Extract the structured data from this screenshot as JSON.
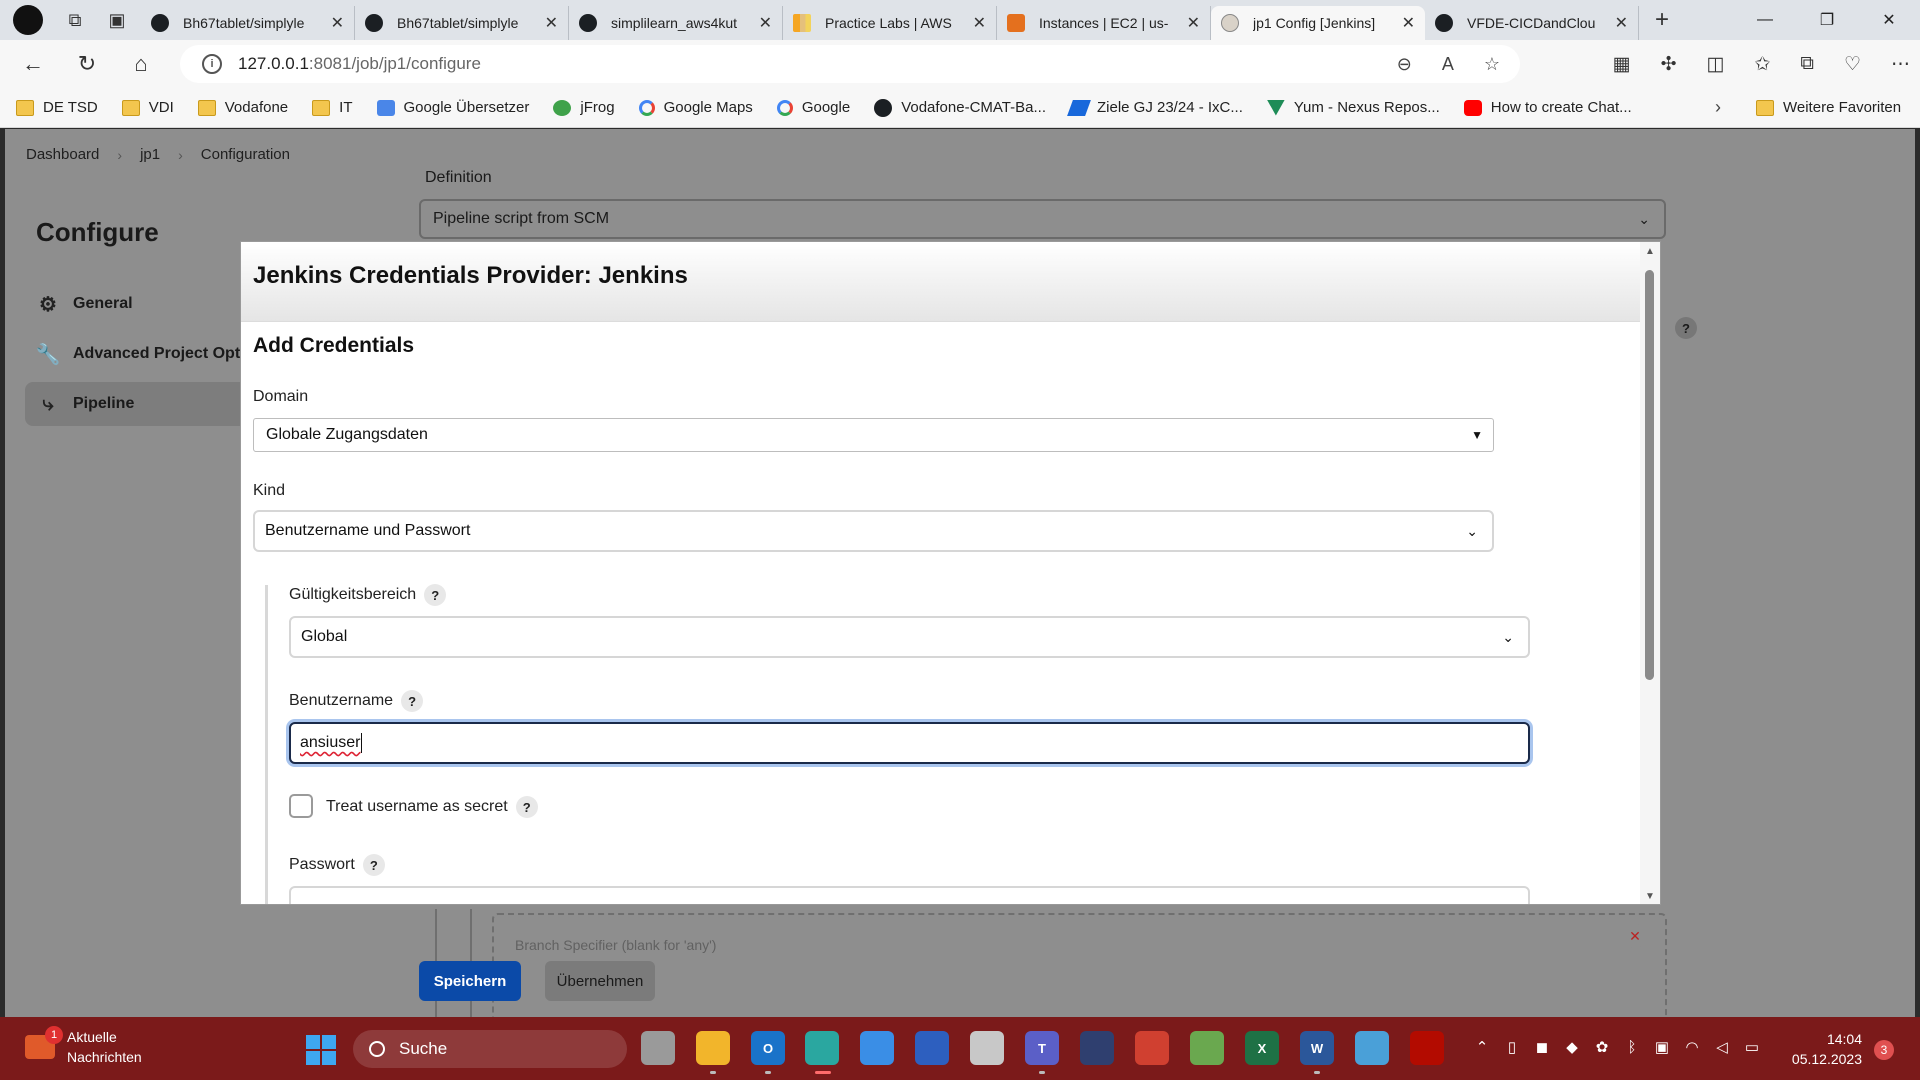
{
  "browser": {
    "tabs": [
      {
        "title": "Bh67tablet/simplyle",
        "icon": "github-icon"
      },
      {
        "title": "Bh67tablet/simplyle",
        "icon": "github-icon"
      },
      {
        "title": "simplilearn_aws4kut",
        "icon": "github-icon"
      },
      {
        "title": "Practice Labs | AWS",
        "icon": "practice-labs-icon"
      },
      {
        "title": "Instances | EC2 | us-",
        "icon": "aws-ec2-icon"
      },
      {
        "title": "jp1 Config [Jenkins]",
        "icon": "jenkins-icon",
        "active": true
      },
      {
        "title": "VFDE-CICDandClou",
        "icon": "github-icon"
      }
    ],
    "url_host": "127.0.0.1",
    "url_rest": ":8081/job/jp1/configure",
    "favorites": [
      {
        "label": "DE TSD",
        "icon": "folder-icon"
      },
      {
        "label": "VDI",
        "icon": "folder-icon"
      },
      {
        "label": "Vodafone",
        "icon": "folder-icon"
      },
      {
        "label": "IT",
        "icon": "folder-icon"
      },
      {
        "label": "Google Übersetzer",
        "icon": "google-translate-icon"
      },
      {
        "label": "jFrog",
        "icon": "jfrog-icon"
      },
      {
        "label": "Google Maps",
        "icon": "google-icon"
      },
      {
        "label": "Google",
        "icon": "google-icon"
      },
      {
        "label": "Vodafone-CMAT-Ba...",
        "icon": "github-icon"
      },
      {
        "label": "Ziele GJ 23/24 - IxC...",
        "icon": "confluence-icon"
      },
      {
        "label": "Yum - Nexus Repos...",
        "icon": "nexus-icon"
      },
      {
        "label": "How to create Chat...",
        "icon": "youtube-icon"
      }
    ],
    "more_favorites": "Weitere Favoriten"
  },
  "jenkins": {
    "breadcrumb": [
      "Dashboard",
      "jp1",
      "Configuration"
    ],
    "page_title": "Configure",
    "sidenav": [
      {
        "label": "General",
        "icon": "gear-icon"
      },
      {
        "label": "Advanced Project Opti",
        "icon": "wrench-icon"
      },
      {
        "label": "Pipeline",
        "icon": "pipeline-icon",
        "active": true
      }
    ],
    "definition_label": "Definition",
    "definition_value": "Pipeline script from SCM",
    "faded_text": "Branch Specifier (blank for 'any')",
    "save_label": "Speichern",
    "apply_label": "Übernehmen"
  },
  "modal": {
    "title": "Jenkins Credentials Provider: Jenkins",
    "section_title": "Add Credentials",
    "domain_label": "Domain",
    "domain_value": "Globale Zugangsdaten",
    "kind_label": "Kind",
    "kind_value": "Benutzername und Passwort",
    "scope_label": "Gültigkeitsbereich",
    "scope_value": "Global",
    "username_label": "Benutzername",
    "username_value": "ansiuser",
    "treat_secret_label": "Treat username as secret",
    "treat_secret_checked": false,
    "password_label": "Passwort",
    "help_glyph": "?"
  },
  "taskbar": {
    "news_title": "Aktuelle",
    "news_subtitle": "Nachrichten",
    "news_badge": "1",
    "search_label": "Suche",
    "time": "14:04",
    "date": "05.12.2023",
    "notifications": "3"
  }
}
